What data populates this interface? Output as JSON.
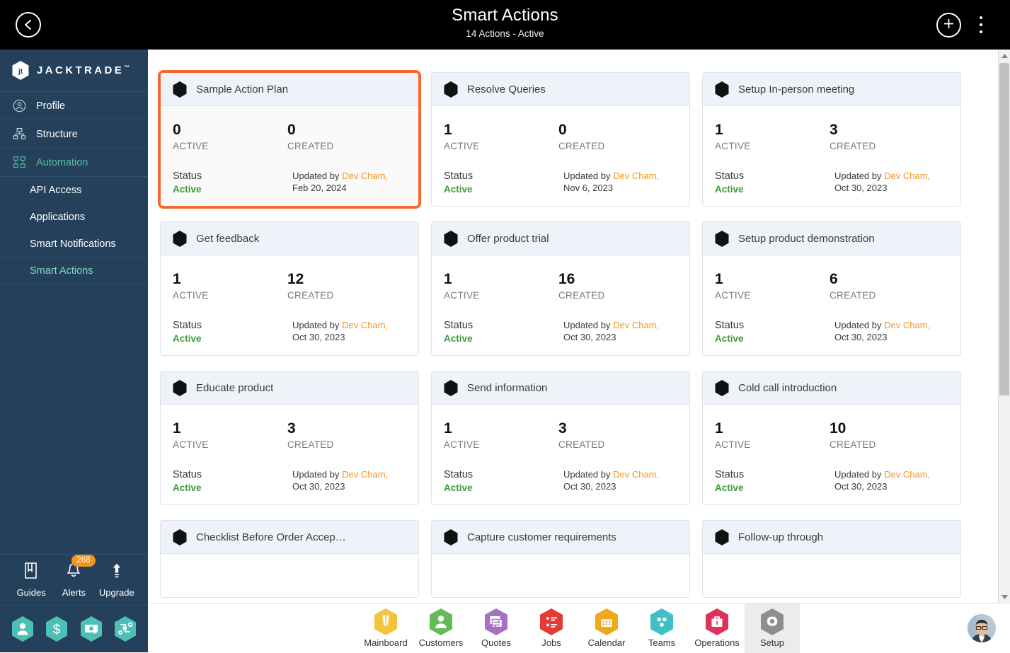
{
  "topbar": {
    "title": "Smart Actions",
    "subtitle": "14 Actions - Active",
    "back_icon": "chevron-left-icon",
    "add_icon": "plus-icon",
    "menu_icon": "kebab-menu-icon"
  },
  "sidebar": {
    "logo": "JACKTRADE",
    "logo_tm": "™",
    "items": [
      {
        "label": "Profile",
        "icon": "user-circle-icon",
        "active": false
      },
      {
        "label": "Structure",
        "icon": "hierarchy-icon",
        "active": false
      },
      {
        "label": "Automation",
        "icon": "automation-flow-icon",
        "active": true
      }
    ],
    "sub_items": [
      {
        "label": "API Access",
        "active": false
      },
      {
        "label": "Applications",
        "active": false
      },
      {
        "label": "Smart Notifications",
        "active": false
      },
      {
        "label": "Smart Actions",
        "active": true
      }
    ],
    "utilities": [
      {
        "label": "Guides",
        "icon": "book-icon",
        "badge": ""
      },
      {
        "label": "Alerts",
        "icon": "bell-icon",
        "badge": "268"
      },
      {
        "label": "Upgrade",
        "icon": "upload-arrow-icon",
        "badge": ""
      }
    ],
    "quick_hexes": [
      {
        "icon": "person-hex-icon"
      },
      {
        "icon": "dollar-hex-icon"
      },
      {
        "icon": "money-transfer-hex-icon"
      },
      {
        "icon": "workflow-hex-icon"
      }
    ],
    "accent_color": "#56bfa5",
    "background_color": "#24405a"
  },
  "main": {
    "labels": {
      "active": "ACTIVE",
      "created": "CREATED",
      "status": "Status",
      "updated_prefix": "Updated by "
    },
    "cards": [
      {
        "title": "Sample Action Plan",
        "active": "0",
        "created": "0",
        "status": "Active",
        "updated_by": "Dev Cham,",
        "updated_date": "Feb 20, 2024",
        "selected": true
      },
      {
        "title": "Resolve Queries",
        "active": "1",
        "created": "0",
        "status": "Active",
        "updated_by": "Dev Cham,",
        "updated_date": "Nov 6, 2023",
        "selected": false
      },
      {
        "title": "Setup In-person meeting",
        "active": "1",
        "created": "3",
        "status": "Active",
        "updated_by": "Dev Cham,",
        "updated_date": "Oct 30, 2023",
        "selected": false
      },
      {
        "title": "Get feedback",
        "active": "1",
        "created": "12",
        "status": "Active",
        "updated_by": "Dev Cham,",
        "updated_date": "Oct 30, 2023",
        "selected": false
      },
      {
        "title": "Offer product trial",
        "active": "1",
        "created": "16",
        "status": "Active",
        "updated_by": "Dev Cham,",
        "updated_date": "Oct 30, 2023",
        "selected": false
      },
      {
        "title": "Setup product demonstration",
        "active": "1",
        "created": "6",
        "status": "Active",
        "updated_by": "Dev Cham,",
        "updated_date": "Oct 30, 2023",
        "selected": false
      },
      {
        "title": "Educate product",
        "active": "1",
        "created": "3",
        "status": "Active",
        "updated_by": "Dev Cham,",
        "updated_date": "Oct 30, 2023",
        "selected": false
      },
      {
        "title": "Send information",
        "active": "1",
        "created": "3",
        "status": "Active",
        "updated_by": "Dev Cham,",
        "updated_date": "Oct 30, 2023",
        "selected": false
      },
      {
        "title": "Cold call introduction",
        "active": "1",
        "created": "10",
        "status": "Active",
        "updated_by": "Dev Cham,",
        "updated_date": "Oct 30, 2023",
        "selected": false
      }
    ],
    "partial_cards": [
      {
        "title": "Checklist Before Order Accep…"
      },
      {
        "title": "Capture customer requirements"
      },
      {
        "title": "Follow-up through"
      }
    ],
    "selected_card_color": "#f4682e",
    "status_color": "#3c9b3c",
    "user_link_color": "#f0951f"
  },
  "bottomnav": {
    "items": [
      {
        "label": "Mainboard",
        "icon": "mainboard-hex-icon",
        "color": "#f5c23b",
        "active": false
      },
      {
        "label": "Customers",
        "icon": "customers-hex-icon",
        "color": "#62bb56",
        "active": false
      },
      {
        "label": "Quotes",
        "icon": "quotes-hex-icon",
        "color": "#a471c4",
        "active": false
      },
      {
        "label": "Jobs",
        "icon": "jobs-hex-icon",
        "color": "#e23c33",
        "active": false
      },
      {
        "label": "Calendar",
        "icon": "calendar-hex-icon",
        "color": "#f0a81e",
        "active": false
      },
      {
        "label": "Teams",
        "icon": "teams-hex-icon",
        "color": "#3fc0c6",
        "active": false
      },
      {
        "label": "Operations",
        "icon": "operations-hex-icon",
        "color": "#e0305c",
        "active": false
      },
      {
        "label": "Setup",
        "icon": "setup-hex-icon",
        "color": "#8e8e8e",
        "active": true
      }
    ],
    "avatar": "user-avatar"
  }
}
